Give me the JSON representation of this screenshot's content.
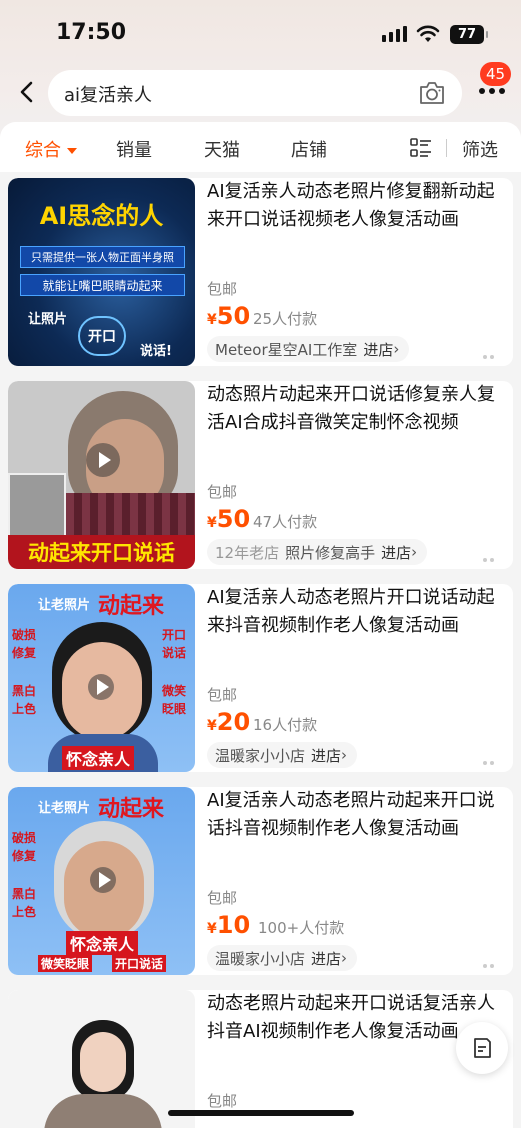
{
  "status": {
    "time": "17:50",
    "battery": "77"
  },
  "search": {
    "query": "ai复活亲人",
    "badge": "45"
  },
  "filters": {
    "tabs": [
      "综合",
      "销量",
      "天猫",
      "店铺"
    ],
    "filter_label": "筛选"
  },
  "products": [
    {
      "title": "AI复活亲人动态老照片修复翻新动起来开口说话视频老人像复活动画",
      "shipping": "包邮",
      "currency": "¥",
      "price": "50",
      "paid": "25人付款",
      "shop": "Meteor星空AI工作室",
      "shop_age": "",
      "enter": "进店",
      "thumb_text": {
        "headline": "AI思念的人",
        "line1": "只需提供一张人物正面半身照",
        "line2": "就能让嘴巴眼睛动起来",
        "left": "让照片",
        "circle": "开口",
        "right": "说话!"
      }
    },
    {
      "title": "动态照片动起来开口说话修复亲人复活AI合成抖音微笑定制怀念视频",
      "shipping": "包邮",
      "currency": "¥",
      "price": "50",
      "paid": "47人付款",
      "shop": "照片修复高手",
      "shop_age": "12年老店",
      "enter": "进店",
      "thumb_text": {
        "banner": "动起来开口说话"
      }
    },
    {
      "title": "AI复活亲人动态老照片开口说话动起来抖音视频制作老人像复活动画",
      "shipping": "包邮",
      "currency": "¥",
      "price": "20",
      "paid": "16人付款",
      "shop": "温暖家小小店",
      "shop_age": "",
      "enter": "进店",
      "thumb_text": {
        "top_small": "让老照片",
        "top_big": "动起来",
        "l1": "破损",
        "l2": "修复",
        "l3": "黑白",
        "l4": "上色",
        "r1": "开口",
        "r2": "说话",
        "r3": "微笑",
        "r4": "眨眼",
        "bottom": "怀念亲人"
      }
    },
    {
      "title": "AI复活亲人动态老照片动起来开口说话抖音视频制作老人像复活动画",
      "shipping": "包邮",
      "currency": "¥",
      "price": "10",
      "paid": "100+人付款",
      "shop": "温暖家小小店",
      "shop_age": "",
      "enter": "进店",
      "thumb_text": {
        "top_small": "让老照片",
        "top_big": "动起来",
        "l1": "破损",
        "l2": "修复",
        "l3": "黑白",
        "l4": "上色",
        "bottom": "怀念亲人",
        "bottom2": "微笑眨眼",
        "bottom3": "开口说话"
      }
    },
    {
      "title": "动态老照片动起来开口说话复活亲人抖音AI视频制作老人像复活动画",
      "shipping": "包邮",
      "currency": "",
      "price": "",
      "paid": "",
      "shop": "",
      "shop_age": "",
      "enter": ""
    }
  ],
  "colors": {
    "accent": "#ff5000",
    "badge": "#ff3b1f"
  },
  "icons": [
    "back-icon",
    "camera-icon",
    "more-icon",
    "list-view-icon",
    "play-icon",
    "feedback-icon"
  ]
}
